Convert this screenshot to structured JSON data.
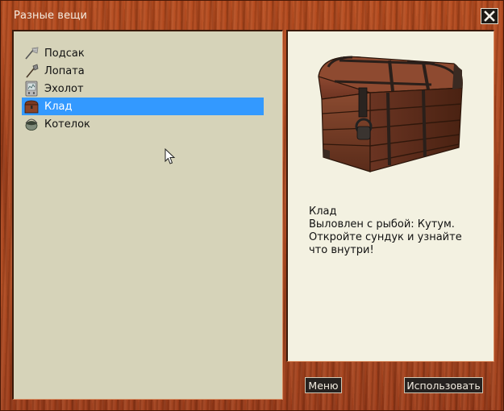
{
  "window": {
    "title": "Разные вещи",
    "close_icon": "close-icon"
  },
  "item_list": {
    "items": [
      {
        "label": "Подсак",
        "icon": "landing-net-icon",
        "selected": false
      },
      {
        "label": "Лопата",
        "icon": "shovel-icon",
        "selected": false
      },
      {
        "label": "Эхолот",
        "icon": "echo-sounder-icon",
        "selected": false
      },
      {
        "label": "Клад",
        "icon": "treasure-chest-icon",
        "selected": true
      },
      {
        "label": "Котелок",
        "icon": "pot-icon",
        "selected": false
      }
    ],
    "selection_color": "#3399ff"
  },
  "details": {
    "preview_icon": "treasure-chest-image",
    "name": "Клад",
    "line1": "Выловлен с рыбой: Кутум.",
    "line2": "Откройте сундук и узнайте",
    "line3": "что внутри!"
  },
  "buttons": {
    "menu_label": "Меню",
    "use_label": "Использовать"
  },
  "colors": {
    "wood": "#a3401a",
    "left_panel": "#d6d3b9",
    "right_panel": "#f3f1e1",
    "button_bg": "#262220"
  }
}
